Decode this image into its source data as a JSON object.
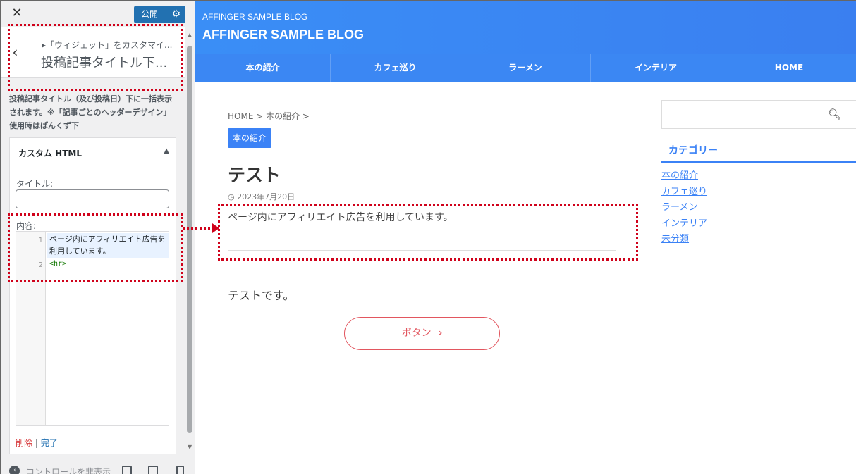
{
  "sidebar": {
    "close_glyph": "✕",
    "publish_label": "公開",
    "back_glyph": "‹",
    "crumb": "▸「ウィジェット」をカスタマイ...",
    "section_title": "投稿記事タイトル下...",
    "description": "投稿記事タイトル（及び投稿日）下に一括表示されます。※「記事ごとのヘッダーデザイン」使用時はぱんくず下",
    "widget": {
      "title": "カスタム HTML",
      "title_label": "タイトル:",
      "title_value": "",
      "content_label": "内容:",
      "code_lines": [
        {
          "num": "1",
          "text": "ページ内にアフィリエイト広告を利用しています。"
        },
        {
          "num": "2",
          "text": "<hr>"
        }
      ],
      "delete_label": "削除",
      "separator": "|",
      "done_label": "完了"
    },
    "footer": {
      "collapse_label": "コントロールを非表示"
    }
  },
  "preview": {
    "site_tagline": "AFFINGER SAMPLE BLOG",
    "site_title": "AFFINGER SAMPLE BLOG",
    "nav": [
      "本の紹介",
      "カフェ巡り",
      "ラーメン",
      "インテリア",
      "HOME"
    ],
    "breadcrumb": "HOME > 本の紹介 >",
    "category_badge": "本の紹介",
    "post_title": "テスト",
    "post_date": "2023年7月20日",
    "affiliate_text": "ページ内にアフィリエイト広告を利用しています。",
    "body_text": "テストです。",
    "button_label": "ボタン",
    "sidebar_widget": {
      "heading": "カテゴリー",
      "categories": [
        "本の紹介",
        "カフェ巡り",
        "ラーメン",
        "インテリア",
        "未分類"
      ]
    }
  },
  "colors": {
    "accent": "#3b82f6",
    "publish": "#2271b1",
    "annotation": "#d0021b",
    "button": "#e2565f"
  }
}
